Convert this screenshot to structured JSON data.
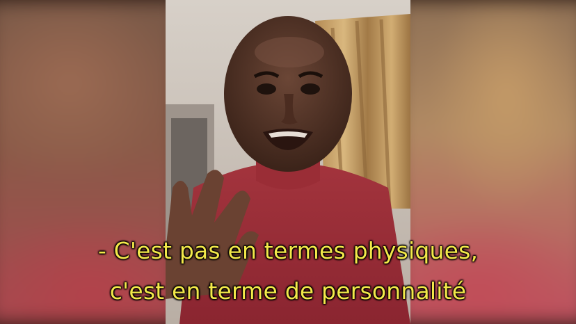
{
  "video": {
    "subtitle_line_1": "- C'est pas en termes physiques,",
    "subtitle_line_2": "c'est en terme de personnalité",
    "subtitle_color": "#f3e94a"
  }
}
